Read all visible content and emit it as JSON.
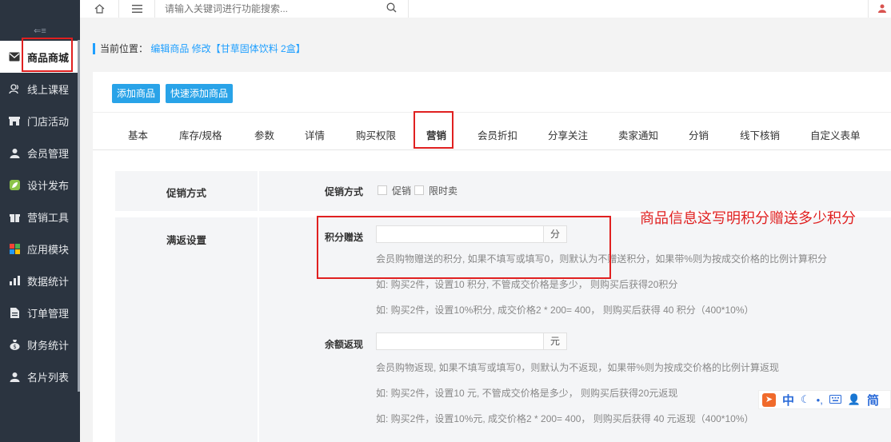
{
  "sidebar": {
    "collapse_icon": "collapse-icon",
    "items": [
      {
        "label": "商品商城",
        "icon": "mail-icon"
      },
      {
        "label": "线上课程",
        "icon": "users-icon"
      },
      {
        "label": "门店活动",
        "icon": "store-icon"
      },
      {
        "label": "会员管理",
        "icon": "user-icon"
      },
      {
        "label": "设计发布",
        "icon": "leaf-icon"
      },
      {
        "label": "营销工具",
        "icon": "gift-icon"
      },
      {
        "label": "应用模块",
        "icon": "apps-icon"
      },
      {
        "label": "数据统计",
        "icon": "bar-chart-icon"
      },
      {
        "label": "订单管理",
        "icon": "document-icon"
      },
      {
        "label": "财务统计",
        "icon": "money-bag-icon"
      },
      {
        "label": "名片列表",
        "icon": "user-icon"
      }
    ]
  },
  "topbar": {
    "search_placeholder": "请输入关键词进行功能搜索..."
  },
  "breadcrumb": {
    "prefix": "当前位置：",
    "path": "编辑商品 修改【甘草固体饮料 2盒】"
  },
  "buttons": {
    "add": "添加商品",
    "quick_add": "快速添加商品"
  },
  "tabs": [
    "基本",
    "库存/规格",
    "参数",
    "详情",
    "购买权限",
    "营销",
    "会员折扣",
    "分享关注",
    "卖家通知",
    "分销",
    "线下核销",
    "自定义表单"
  ],
  "active_tab": "营销",
  "promo": {
    "section": "促销方式",
    "field": "促销方式",
    "opt1": "促销",
    "opt2": "限时卖"
  },
  "rebate": {
    "section": "满返设置",
    "points_label": "积分赠送",
    "points_unit": "分",
    "points_help1": "会员购物赠送的积分, 如果不填写或填写0，则默认为不赠送积分，如果带%则为按成交价格的比例计算积分",
    "points_help2": "如: 购买2件，设置10 积分, 不管成交价格是多少， 则购买后获得20积分",
    "points_help3": "如: 购买2件，设置10%积分, 成交价格2 * 200= 400， 则购买后获得 40 积分（400*10%）",
    "balance_label": "余额返现",
    "balance_unit": "元",
    "balance_help1": "会员购物返现, 如果不填写或填写0，则默认为不返现，如果带%则为按成交价格的比例计算返现",
    "balance_help2": "如: 购买2件，设置10 元, 不管成交价格是多少， 则购买后获得20元返现",
    "balance_help3": "如: 购买2件，设置10%元, 成交价格2 * 200= 400， 则购买后获得 40 元返现（400*10%）"
  },
  "annotation": "商品信息这写明积分赠送多少积分",
  "ime": {
    "lang": "中",
    "mode": "简"
  }
}
